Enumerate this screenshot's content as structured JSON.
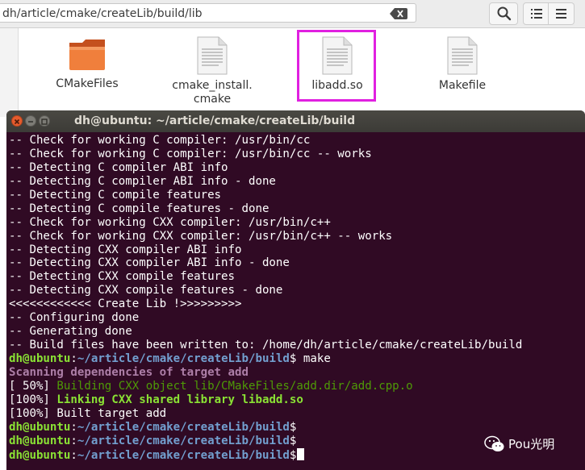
{
  "file_manager": {
    "path": "dh/article/cmake/createLib/build/lib",
    "files": [
      {
        "name": "CMakeFiles",
        "kind": "folder"
      },
      {
        "name": "cmake_install.\ncmake",
        "kind": "document"
      },
      {
        "name": "libadd.so",
        "kind": "document"
      },
      {
        "name": "Makefile",
        "kind": "document"
      }
    ],
    "icons": {
      "search": "search-icon",
      "list": "list-view-icon",
      "menu": "menu-icon",
      "clear": "clear-icon"
    },
    "highlight_color": "#e020e0"
  },
  "terminal": {
    "title": "dh@ubuntu: ~/article/cmake/createLib/build",
    "background": "#300a24",
    "lines": [
      {
        "segments": [
          {
            "text": "-- Check for working C compiler: /usr/bin/cc",
            "style": "plain"
          }
        ]
      },
      {
        "segments": [
          {
            "text": "-- Check for working C compiler: /usr/bin/cc -- works",
            "style": "plain"
          }
        ]
      },
      {
        "segments": [
          {
            "text": "-- Detecting C compiler ABI info",
            "style": "plain"
          }
        ]
      },
      {
        "segments": [
          {
            "text": "-- Detecting C compiler ABI info - done",
            "style": "plain"
          }
        ]
      },
      {
        "segments": [
          {
            "text": "-- Detecting C compile features",
            "style": "plain"
          }
        ]
      },
      {
        "segments": [
          {
            "text": "-- Detecting C compile features - done",
            "style": "plain"
          }
        ]
      },
      {
        "segments": [
          {
            "text": "-- Check for working CXX compiler: /usr/bin/c++",
            "style": "plain"
          }
        ]
      },
      {
        "segments": [
          {
            "text": "-- Check for working CXX compiler: /usr/bin/c++ -- works",
            "style": "plain"
          }
        ]
      },
      {
        "segments": [
          {
            "text": "-- Detecting CXX compiler ABI info",
            "style": "plain"
          }
        ]
      },
      {
        "segments": [
          {
            "text": "-- Detecting CXX compiler ABI info - done",
            "style": "plain"
          }
        ]
      },
      {
        "segments": [
          {
            "text": "-- Detecting CXX compile features",
            "style": "plain"
          }
        ]
      },
      {
        "segments": [
          {
            "text": "-- Detecting CXX compile features - done",
            "style": "plain"
          }
        ]
      },
      {
        "segments": [
          {
            "text": "<<<<<<<<<<<< Create Lib !>>>>>>>>>",
            "style": "plain"
          }
        ]
      },
      {
        "segments": [
          {
            "text": "-- Configuring done",
            "style": "plain"
          }
        ]
      },
      {
        "segments": [
          {
            "text": "-- Generating done",
            "style": "plain"
          }
        ]
      },
      {
        "segments": [
          {
            "text": "-- Build files have been written to: /home/dh/article/cmake/createLib/build",
            "style": "plain"
          }
        ]
      },
      {
        "segments": [
          {
            "text": "dh@ubuntu",
            "style": "user"
          },
          {
            "text": ":",
            "style": "plain"
          },
          {
            "text": "~/article/cmake/createLib/build",
            "style": "path"
          },
          {
            "text": "$ make",
            "style": "plain"
          }
        ]
      },
      {
        "segments": [
          {
            "text": "Scanning dependencies of target add",
            "style": "magenta"
          }
        ]
      },
      {
        "segments": [
          {
            "text": "[ 50%] ",
            "style": "plain"
          },
          {
            "text": "Building CXX object lib/CMakeFiles/add.dir/add.cpp.o",
            "style": "green"
          }
        ]
      },
      {
        "segments": [
          {
            "text": "[100%] ",
            "style": "plain"
          },
          {
            "text": "Linking CXX shared library libadd.so",
            "style": "green-bold"
          }
        ]
      },
      {
        "segments": [
          {
            "text": "[100%] Built target add",
            "style": "plain"
          }
        ]
      },
      {
        "segments": [
          {
            "text": "dh@ubuntu",
            "style": "user"
          },
          {
            "text": ":",
            "style": "plain"
          },
          {
            "text": "~/article/cmake/createLib/build",
            "style": "path"
          },
          {
            "text": "$",
            "style": "plain"
          }
        ]
      },
      {
        "segments": [
          {
            "text": "dh@ubuntu",
            "style": "user"
          },
          {
            "text": ":",
            "style": "plain"
          },
          {
            "text": "~/article/cmake/createLib/build",
            "style": "path"
          },
          {
            "text": "$",
            "style": "plain"
          }
        ]
      },
      {
        "segments": [
          {
            "text": "dh@ubuntu",
            "style": "user"
          },
          {
            "text": ":",
            "style": "plain"
          },
          {
            "text": "~/article/cmake/createLib/build",
            "style": "path"
          },
          {
            "text": "$",
            "style": "plain"
          }
        ],
        "cursor": true
      }
    ]
  },
  "watermark": {
    "text": "Pou光明",
    "icon": "wechat-icon"
  }
}
